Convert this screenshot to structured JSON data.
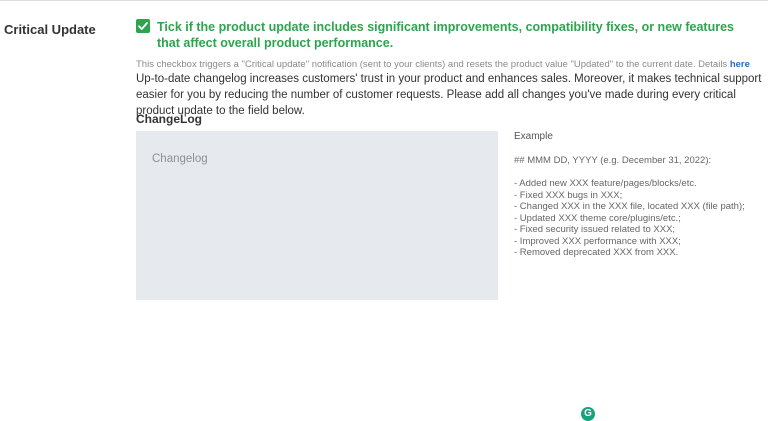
{
  "row": {
    "label": "Critical Update"
  },
  "checkbox": {
    "checked": true,
    "label": "Tick if the product update includes significant improvements, compatibility fixes, or new features that affect overall product performance.",
    "accent_color": "#2ea44f"
  },
  "helper": {
    "text": "This checkbox triggers a \"Critical update\" notification (sent to your clients) and resets the product value \"Updated\" to the current date. Details",
    "link": "here"
  },
  "description": "Up-to-date changelog increases customers' trust in your product and enhances sales. Moreover, it makes technical support easier for you by reducing the number of customer requests. Please add all changes you've made during every critical product update to the field below.",
  "changelog": {
    "title": "ChangeLog",
    "placeholder": "Changelog",
    "value": "",
    "extension_icon": "grammarly-icon",
    "extension_letter": "G"
  },
  "example": {
    "title": "Example",
    "format": "## MMM DD, YYYY (e.g. December 31, 2022):",
    "lines": [
      "- Added new XXX feature/pages/blocks/etc.",
      "- Fixed XXX bugs in XXX;",
      "- Changed XXX in the XXX file, located XXX (file path);",
      "- Updated XXX theme core/plugins/etc.;",
      "- Fixed security issued related to XXX;",
      "- Improved XXX performance with XXX;",
      "- Removed deprecated XXX from XXX."
    ]
  }
}
